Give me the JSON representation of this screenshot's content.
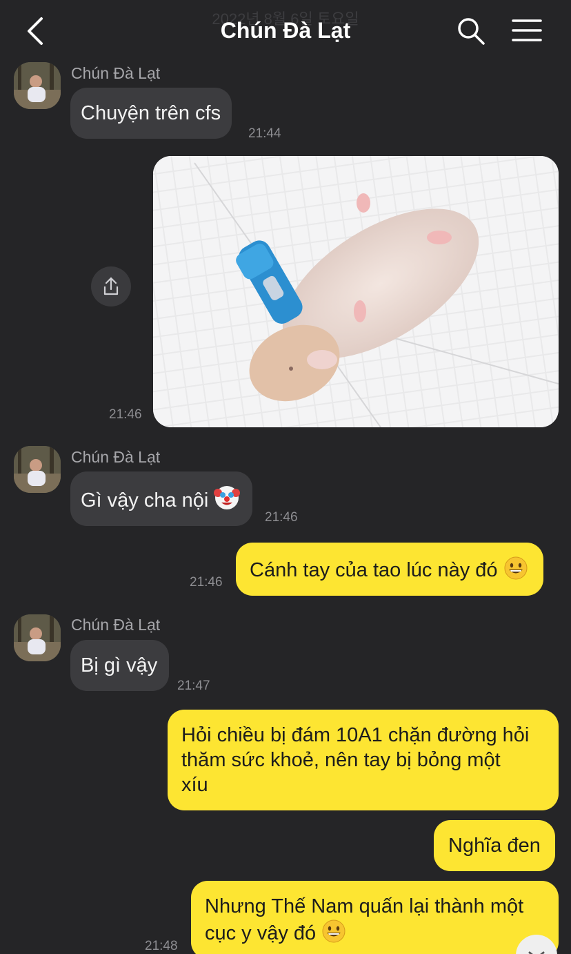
{
  "header": {
    "date": "2022년 8월 6일 토요일",
    "title": "Chún Đà Lạt",
    "back_icon": "chevron-left-icon",
    "search_icon": "search-icon",
    "menu_icon": "hamburger-menu-icon"
  },
  "colors": {
    "background": "#252527",
    "incoming_bubble": "#3c3c3f",
    "outgoing_bubble": "#fde532",
    "timestamp": "#8e8e92"
  },
  "messages": [
    {
      "direction": "in",
      "sender": "Chún Đà Lạt",
      "text": "Chuyện trên cfs",
      "time": "21:44"
    },
    {
      "direction": "out",
      "type": "image",
      "image_desc": "hamster-with-blue-bandaged-arm",
      "time": "21:46"
    },
    {
      "direction": "in",
      "sender": "Chún Đà Lạt",
      "text": "Gì vậy cha nội",
      "emoji": "clown-face-emoji",
      "time": "21:46"
    },
    {
      "direction": "out",
      "text": "Cánh tay của tao lúc này đó",
      "emoji": "grinning-face-emoji",
      "time": "21:46"
    },
    {
      "direction": "in",
      "sender": "Chún Đà Lạt",
      "text": "Bị gì vậy",
      "time": "21:47"
    },
    {
      "direction": "out",
      "lines": [
        "Hỏi chiều bị đám 10A1 chặn đường hỏi",
        "thăm sức khoẻ, nên tay bị bỏng một",
        "xíu"
      ]
    },
    {
      "direction": "out",
      "text": "Nghĩa đen"
    },
    {
      "direction": "out",
      "lines": [
        "Nhưng Thế Nam quấn lại thành một",
        "cục y vậy đó"
      ],
      "emoji": "grinning-face-emoji",
      "time": "21:48"
    }
  ],
  "share_icon": "share-upload-icon",
  "scroll_icon": "chevron-down-icon"
}
